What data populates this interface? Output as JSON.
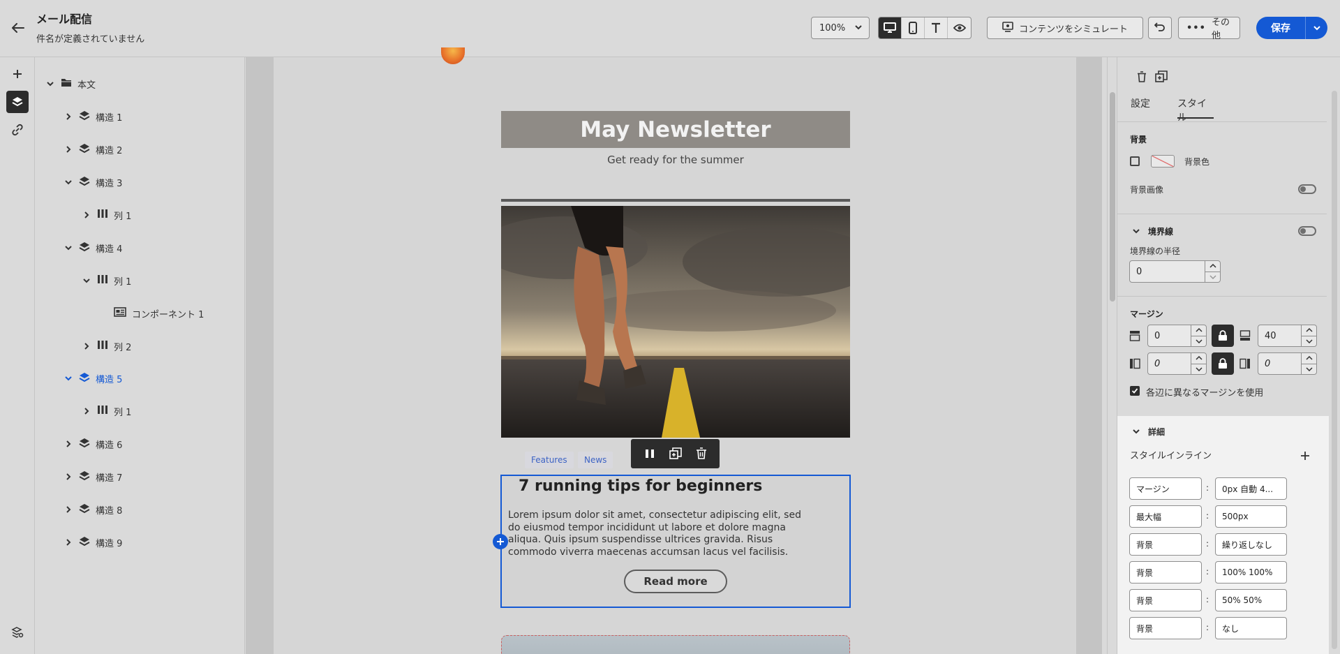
{
  "header": {
    "title": "メール配信",
    "subtitle": "件名が定義されていません",
    "zoom": "100%",
    "simulate_label": "コンテンツをシミュレート",
    "more_label": "その他",
    "save_label": "保存"
  },
  "tree": {
    "root_label": "本文",
    "items": [
      {
        "label": "構造 1"
      },
      {
        "label": "構造 2"
      },
      {
        "label": "構造 3"
      },
      {
        "label": "列 1"
      },
      {
        "label": "構造 4"
      },
      {
        "label": "列 1"
      },
      {
        "label": "コンポーネント 1"
      },
      {
        "label": "列 2"
      },
      {
        "label": "構造 5"
      },
      {
        "label": "列 1"
      },
      {
        "label": "構造 6"
      },
      {
        "label": "構造 7"
      },
      {
        "label": "構造 8"
      },
      {
        "label": "構造 9"
      }
    ]
  },
  "email": {
    "banner_title": "May Newsletter",
    "banner_subtitle": "Get ready for the summer",
    "tags": [
      "Features",
      "News"
    ],
    "article_title": "7 running tips for beginners",
    "article_body": "Lorem ipsum dolor sit amet, consectetur adipiscing elit, sed do eiusmod tempor incididunt ut labore et dolore magna aliqua. Quis ipsum suspendisse ultrices gravida. Risus commodo viverra maecenas accumsan lacus vel facilisis.",
    "read_more": "Read more"
  },
  "panel": {
    "tab_settings": "設定",
    "tab_style": "スタイル",
    "background_heading": "背景",
    "background_color_label": "背景色",
    "background_image_label": "背景画像",
    "border_heading": "境界線",
    "border_radius_label": "境界線の半径",
    "border_radius_value": "0",
    "margin_heading": "マージン",
    "margin_top": "0",
    "margin_bottom": "40",
    "margin_left": "0",
    "margin_right": "0",
    "different_margins_label": "各辺に異なるマージンを使用",
    "details_heading": "詳細",
    "inline_style_label": "スタイルインライン",
    "inline_styles": [
      {
        "key": "マージン",
        "value": "0px 自動 4..."
      },
      {
        "key": "最大幅",
        "value": "500px"
      },
      {
        "key": "背景",
        "value": "繰り返しなし"
      },
      {
        "key": "背景",
        "value": "100% 100%"
      },
      {
        "key": "背景",
        "value": "50% 50%"
      },
      {
        "key": "背景",
        "value": "なし"
      }
    ]
  },
  "colors": {
    "accent": "#1459d4",
    "dark": "#2c2c2c",
    "banner": "#8f8b86"
  }
}
